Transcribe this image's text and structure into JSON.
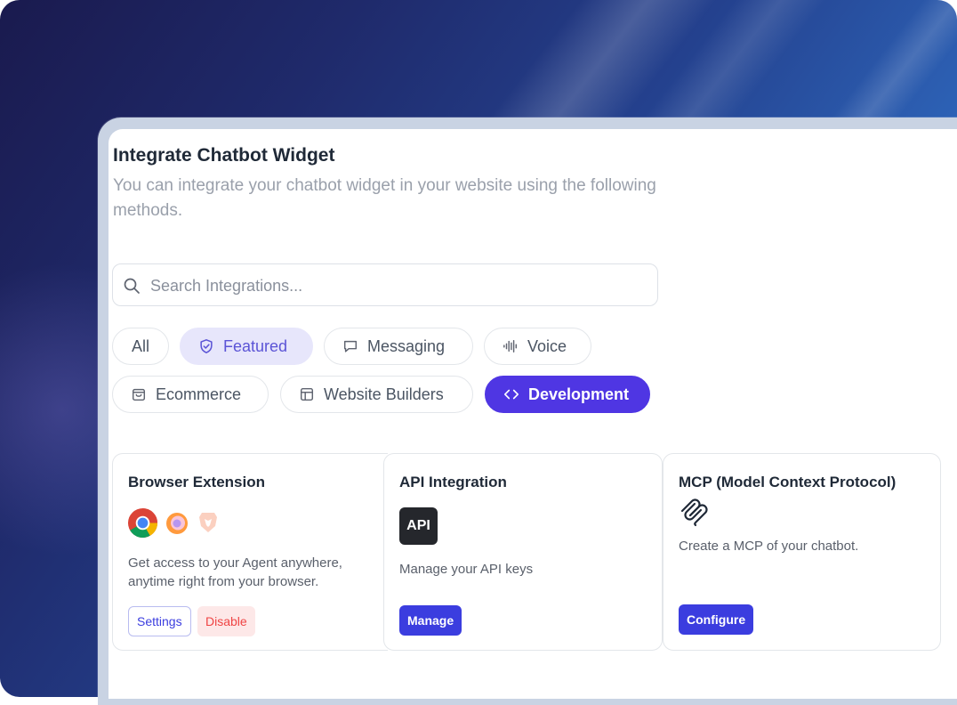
{
  "header": {
    "title": "Integrate Chatbot Widget",
    "subtitle": "You can integrate your chatbot widget in your website using the following methods."
  },
  "search": {
    "placeholder": "Search Integrations..."
  },
  "filters": [
    {
      "label": "All",
      "icon": "none",
      "state": "default"
    },
    {
      "label": "Featured",
      "icon": "shield-check-icon",
      "state": "highlighted"
    },
    {
      "label": "Messaging",
      "icon": "message-icon",
      "state": "default"
    },
    {
      "label": "Voice",
      "icon": "waveform-icon",
      "state": "default"
    },
    {
      "label": "Ecommerce",
      "icon": "shopping-bag-icon",
      "state": "default"
    },
    {
      "label": "Website Builders",
      "icon": "layout-icon",
      "state": "default"
    },
    {
      "label": "Development",
      "icon": "code-icon",
      "state": "active"
    }
  ],
  "cards": [
    {
      "title": "Browser Extension",
      "icons": [
        "chrome-icon",
        "firefox-icon",
        "brave-icon"
      ],
      "description": "Get access to your Agent anywhere, anytime right from your browser.",
      "buttons": {
        "settings": "Settings",
        "disable": "Disable"
      }
    },
    {
      "title": "API Integration",
      "badge": "API",
      "description": "Manage your API keys",
      "buttons": {
        "manage": "Manage"
      }
    },
    {
      "title": "MCP (Model Context Protocol)",
      "icons": [
        "mcp-icon"
      ],
      "description": "Create a MCP of your chatbot.",
      "buttons": {
        "configure": "Configure"
      }
    }
  ],
  "colors": {
    "accent": "#4f36e3",
    "button_primary": "#3b3ddf",
    "featured_bg": "#e7e6fb",
    "danger": "#ef4444"
  }
}
